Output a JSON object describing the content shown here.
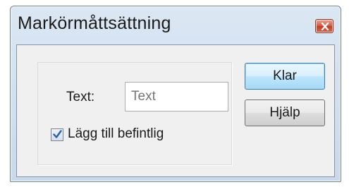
{
  "window": {
    "title": "Markörmåttsättning"
  },
  "form": {
    "text_label": "Text:",
    "text_placeholder": "Text",
    "text_value": "",
    "append_checkbox_label": "Lägg till befintlig",
    "append_checked": true
  },
  "buttons": {
    "ok_label": "Klar",
    "help_label": "Hjälp"
  },
  "icons": {
    "close": "close-x-icon",
    "check": "checkmark-icon"
  },
  "colors": {
    "close_button": "#c23b22",
    "default_button_border": "#3c7fb1",
    "checkmark": "#2a5ea8"
  }
}
